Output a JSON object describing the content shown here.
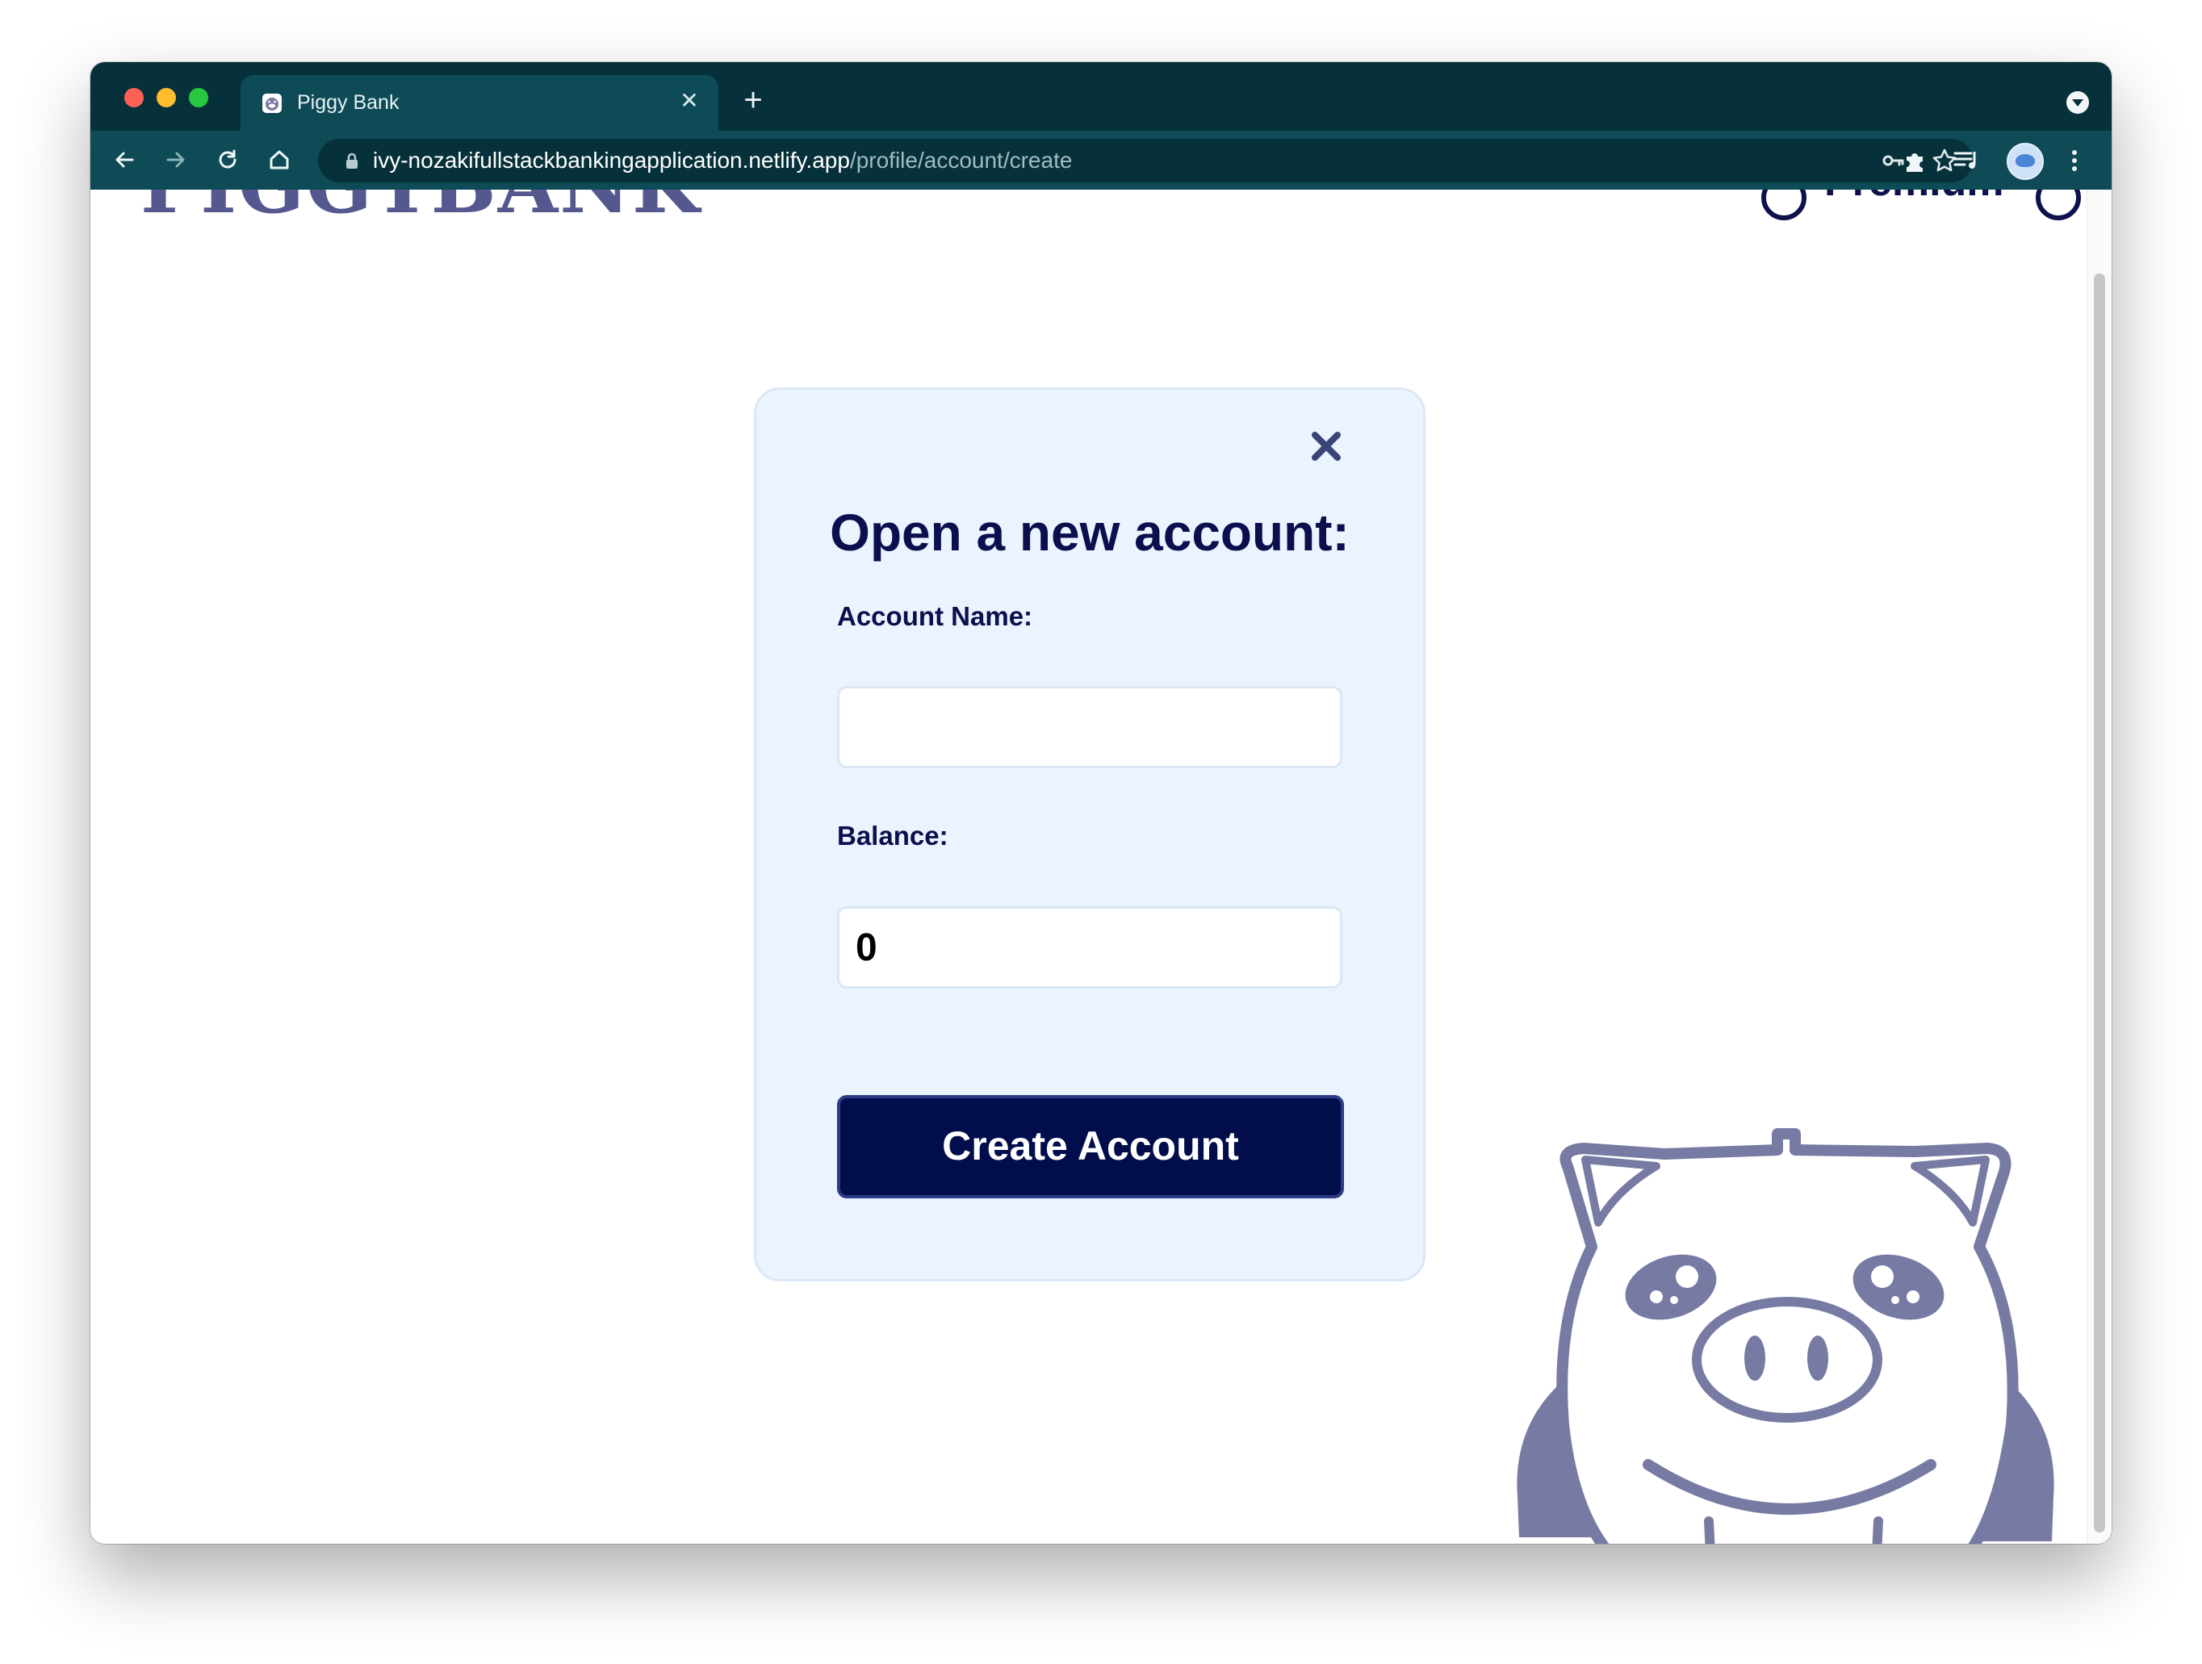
{
  "browser": {
    "tab_title": "Piggy Bank",
    "url_host": "ivy-nozakifullstackbankingapplication.netlify.app",
    "url_path": "/profile/account/create"
  },
  "header": {
    "logo_text": "PIGGYBANK",
    "nav_text": "Premium"
  },
  "modal": {
    "title": "Open a new account:",
    "account_name_label": "Account Name:",
    "account_name_value": "",
    "balance_label": "Balance:",
    "balance_value": "0",
    "submit_label": "Create Account"
  },
  "colors": {
    "navy": "#0b0f4d",
    "button": "#020e4b",
    "modal_bg": "#ebf3fe",
    "pig": "#777ba3",
    "browser_frame": "#07313a",
    "browser_toolbar": "#0e4b57"
  },
  "icons": [
    "close-icon",
    "back-icon",
    "forward-icon",
    "reload-icon",
    "home-icon",
    "lock-icon",
    "key-icon",
    "star-icon",
    "extensions-icon",
    "media-icon",
    "menu-icon",
    "piggy-bank-illustration"
  ]
}
